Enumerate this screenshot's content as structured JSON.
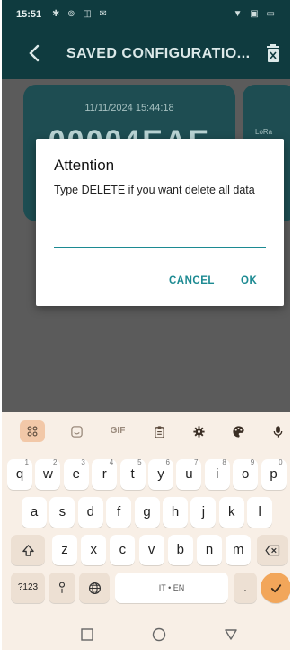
{
  "status": {
    "time": "15:51",
    "left_icons": "✱ ⊚ ◫ ✉",
    "right_icons": "▼ ▣ ▭"
  },
  "appbar": {
    "title": "SAVED CONFIGURATIO..."
  },
  "card": {
    "date": "11/11/2024 15:44:18",
    "id": "00004EAE",
    "side_label": "LoRa"
  },
  "dialog": {
    "title": "Attention",
    "message": "Type DELETE if you want delete all data",
    "input_value": "",
    "cancel_label": "CANCEL",
    "ok_label": "OK"
  },
  "keyboard": {
    "toolbar_gif": "GIF",
    "row1": [
      {
        "key": "q",
        "hint": "1"
      },
      {
        "key": "w",
        "hint": "2"
      },
      {
        "key": "e",
        "hint": "3"
      },
      {
        "key": "r",
        "hint": "4"
      },
      {
        "key": "t",
        "hint": "5"
      },
      {
        "key": "y",
        "hint": "6"
      },
      {
        "key": "u",
        "hint": "7"
      },
      {
        "key": "i",
        "hint": "8"
      },
      {
        "key": "o",
        "hint": "9"
      },
      {
        "key": "p",
        "hint": "0"
      }
    ],
    "row2": [
      "a",
      "s",
      "d",
      "f",
      "g",
      "h",
      "j",
      "k",
      "l"
    ],
    "row3": [
      "z",
      "x",
      "c",
      "v",
      "b",
      "n",
      "m"
    ],
    "symbols_label": "?123",
    "space_label": "IT • EN",
    "period_label": ".",
    "comma_label": ","
  },
  "colors": {
    "accent": "#1c8a92",
    "appbar_dimmed": "#0f3b3f",
    "keyboard_bg": "#f8efe6",
    "enter_key": "#f2a65a"
  }
}
